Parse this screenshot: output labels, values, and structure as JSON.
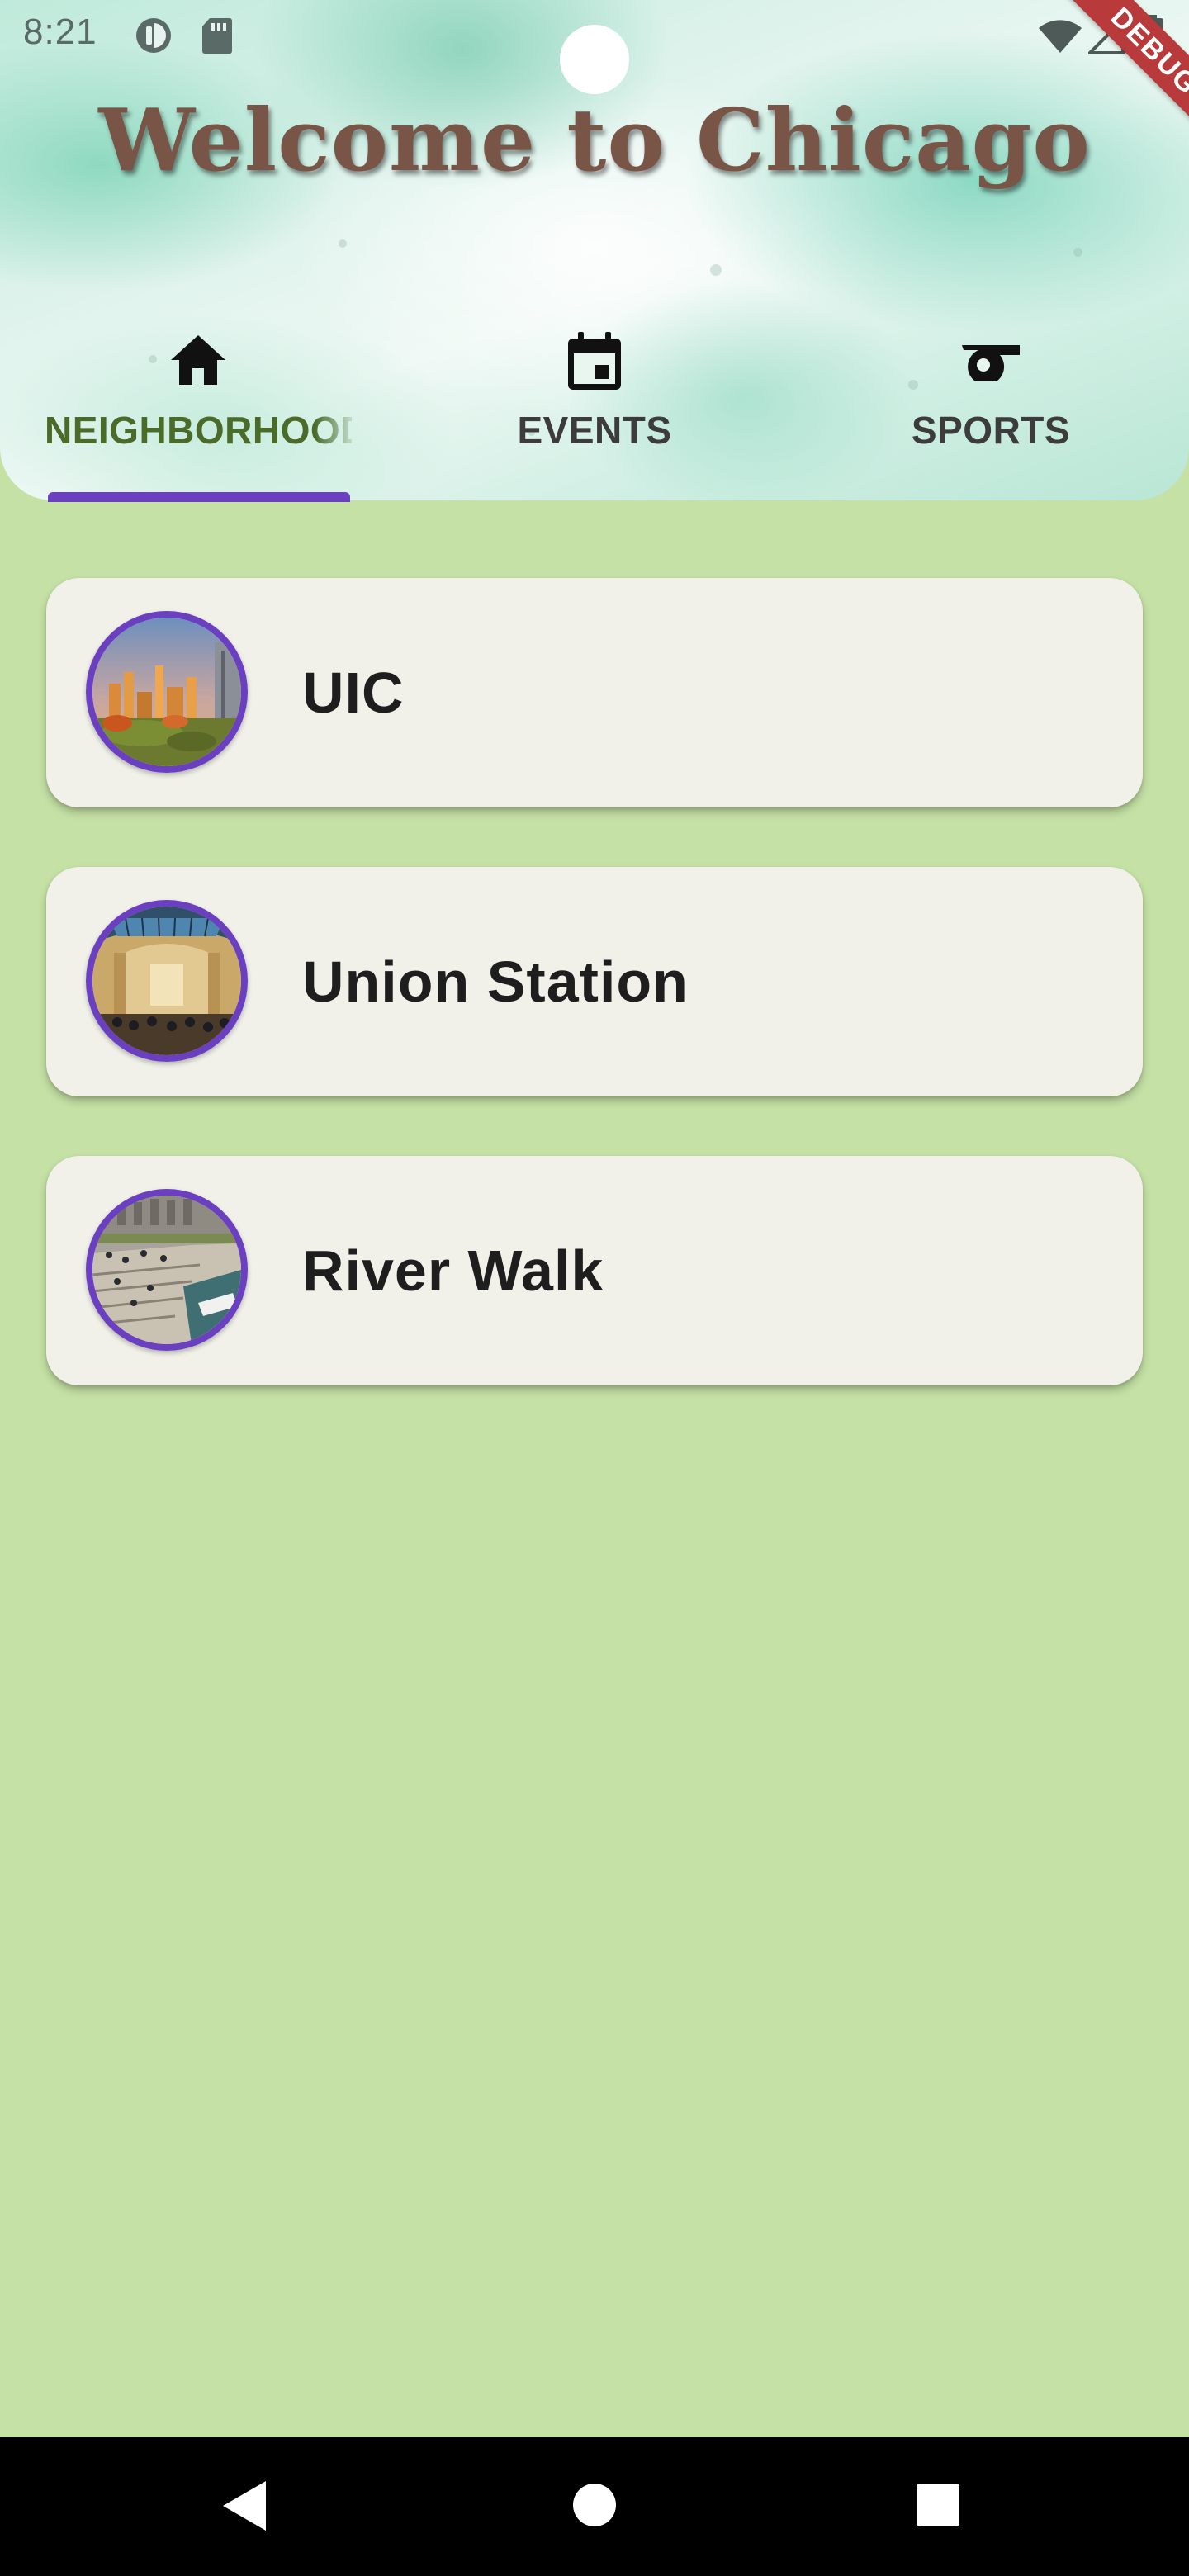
{
  "status_bar": {
    "time": "8:21",
    "icons": [
      "sync-icon",
      "sd-card-icon",
      "wifi-icon",
      "signal-icon",
      "battery-icon"
    ]
  },
  "debug_banner": "DEBUG",
  "header": {
    "title": "Welcome to Chicago"
  },
  "tabs": [
    {
      "label": "NEIGHBORHOODS",
      "icon": "home-icon",
      "active": true
    },
    {
      "label": "EVENTS",
      "icon": "calendar-icon",
      "active": false
    },
    {
      "label": "SPORTS",
      "icon": "whistle-icon",
      "active": false
    }
  ],
  "places": [
    {
      "name": "UIC",
      "image": "uic-campus-skyline-photo"
    },
    {
      "name": "Union Station",
      "image": "union-station-great-hall-photo"
    },
    {
      "name": "River Walk",
      "image": "chicago-riverwalk-photo"
    }
  ],
  "nav": {
    "back": "back-icon",
    "home": "home-circle-icon",
    "recents": "recents-square-icon"
  },
  "colors": {
    "page_background": "#c5e1a5",
    "title_color": "#795548",
    "accent": "#6a3fc0",
    "active_tab_label": "#4a6b2a",
    "card_background": "#f1f1ea",
    "debug_banner": "#b83a3a"
  }
}
